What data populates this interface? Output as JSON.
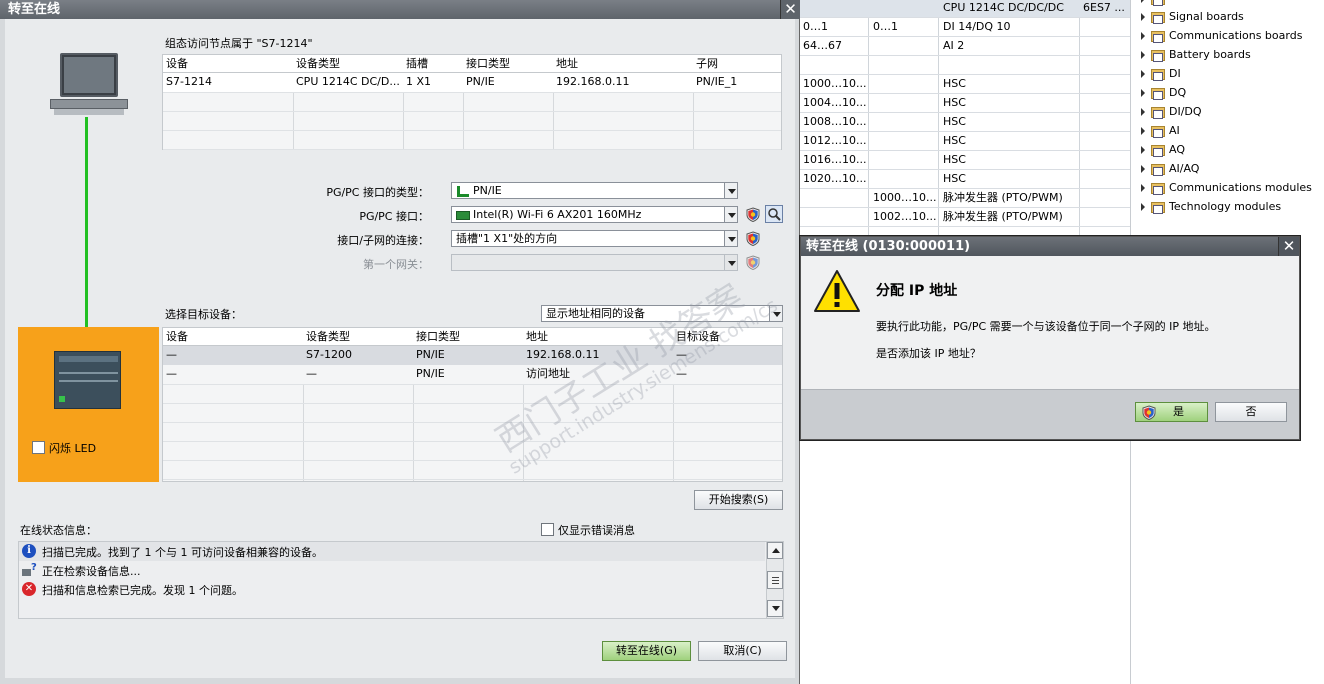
{
  "background_table": {
    "rows": [
      {
        "c1": "",
        "c2": "",
        "c3": "CPU 1214C DC/DC/DC",
        "c4": "6ES7 ..."
      },
      {
        "c1": "0…1",
        "c2": "0…1",
        "c3": "DI 14/DQ 10",
        "c4": ""
      },
      {
        "c1": "64…67",
        "c2": "",
        "c3": "AI 2",
        "c4": ""
      },
      {
        "c1": "",
        "c2": "",
        "c3": "",
        "c4": ""
      },
      {
        "c1": "1000…10...",
        "c2": "",
        "c3": "HSC",
        "c4": ""
      },
      {
        "c1": "1004…10...",
        "c2": "",
        "c3": "HSC",
        "c4": ""
      },
      {
        "c1": "1008…10...",
        "c2": "",
        "c3": "HSC",
        "c4": ""
      },
      {
        "c1": "1012…10...",
        "c2": "",
        "c3": "HSC",
        "c4": ""
      },
      {
        "c1": "1016…10...",
        "c2": "",
        "c3": "HSC",
        "c4": ""
      },
      {
        "c1": "1020…10...",
        "c2": "",
        "c3": "HSC",
        "c4": ""
      },
      {
        "c1": "",
        "c2": "1000…10...",
        "c3": "脉冲发生器 (PTO/PWM)",
        "c4": ""
      },
      {
        "c1": "",
        "c2": "1002…10...",
        "c3": "脉冲发生器 (PTO/PWM)",
        "c4": ""
      }
    ]
  },
  "catalog": {
    "items": [
      "Signal boards",
      "Communications boards",
      "Battery boards",
      "DI",
      "DQ",
      "DI/DQ",
      "AI",
      "AQ",
      "AI/AQ",
      "Communications modules",
      "Technology modules"
    ]
  },
  "main_dialog": {
    "title": "转至在线",
    "close": "✕",
    "config_label": "组态访问节点属于 \"S7-1214\"",
    "config_table": {
      "headers": [
        "设备",
        "设备类型",
        "插槽",
        "接口类型",
        "地址",
        "子网"
      ],
      "rows": [
        [
          "S7-1214",
          "CPU 1214C DC/D...",
          "1 X1",
          "PN/IE",
          "192.168.0.11",
          "PN/IE_1"
        ]
      ]
    },
    "pgpc_type_label": "PG/PC 接口的类型：",
    "pgpc_type_value": "PN/IE",
    "pgpc_iface_label": "PG/PC 接口：",
    "pgpc_iface_value": "Intel(R) Wi-Fi 6 AX201 160MHz",
    "subnet_conn_label": "接口/子网的连接：",
    "subnet_conn_value": "插槽\"1 X1\"处的方向",
    "gateway_label": "第一个网关：",
    "gateway_value": "",
    "select_target_label": "选择目标设备：",
    "filter_value": "显示地址相同的设备",
    "target_table": {
      "headers": [
        "设备",
        "设备类型",
        "接口类型",
        "地址",
        "目标设备"
      ],
      "rows": [
        [
          "—",
          "S7-1200",
          "PN/IE",
          "192.168.0.11",
          "—"
        ],
        [
          "—",
          "—",
          "PN/IE",
          "访问地址",
          "—"
        ]
      ]
    },
    "flash_led_label": "闪烁 LED",
    "start_search": "开始搜索(S)",
    "status_label": "在线状态信息：",
    "errors_only_label": "仅显示错误消息",
    "messages": [
      "扫描已完成。找到了 1 个与 1 可访问设备相兼容的设备。",
      "正在检索设备信息...",
      "扫描和信息检索已完成。发现 1 个问题。"
    ],
    "go_online": "转至在线(G)",
    "cancel": "取消(C)"
  },
  "ip_dialog": {
    "title": "转至在线 (0130:000011)",
    "close": "✕",
    "heading": "分配 IP 地址",
    "line1": "要执行此功能，PG/PC 需要一个与该设备位于同一个子网的 IP 地址。",
    "line2": "是否添加该 IP 地址？",
    "yes": "是",
    "no": "否"
  },
  "watermark": {
    "line1": "西门子工业 找答案",
    "line2": "support.industry.siemens.com/cs"
  },
  "colors": {
    "accent_orange": "#f7a11a",
    "go_online_green": "#9fd17d",
    "link_green": "#22c022"
  }
}
